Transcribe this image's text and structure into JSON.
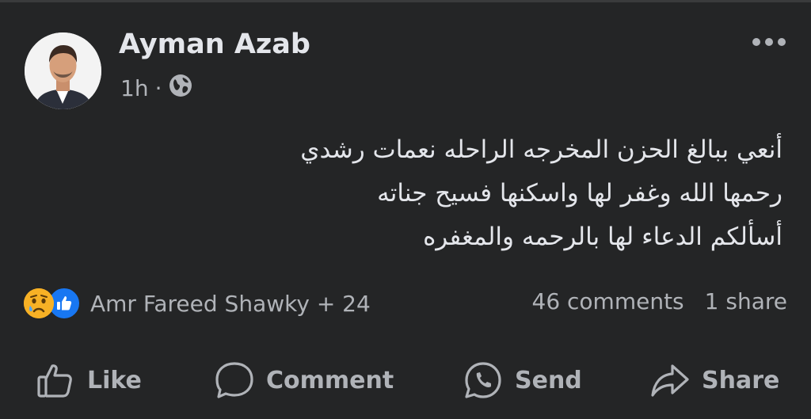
{
  "post": {
    "author": "Ayman Azab",
    "time": "1h",
    "separator": "·",
    "privacy_icon": "globe-icon",
    "menu_icon": "more-horizontal-icon",
    "text_lines": [
      "أنعي ببالغ الحزن المخرجه الراحله نعمات رشدي",
      "رحمها الله وغفر لها واسكنها فسيح جناته",
      "أسألكم الدعاء لها بالرحمه والمغفره"
    ]
  },
  "reactions": {
    "icons": [
      "sad-reaction-icon",
      "like-reaction-icon"
    ],
    "names": "Amr Fareed Shawky + 24",
    "comments": "46 comments",
    "shares": "1 share"
  },
  "actions": {
    "like": "Like",
    "comment": "Comment",
    "send": "Send",
    "share": "Share"
  },
  "colors": {
    "background": "#242526",
    "text_primary": "#e4e6eb",
    "text_secondary": "#b0b3b8",
    "like_blue": "#1877f2",
    "sad_yellow": "#f7b125"
  }
}
